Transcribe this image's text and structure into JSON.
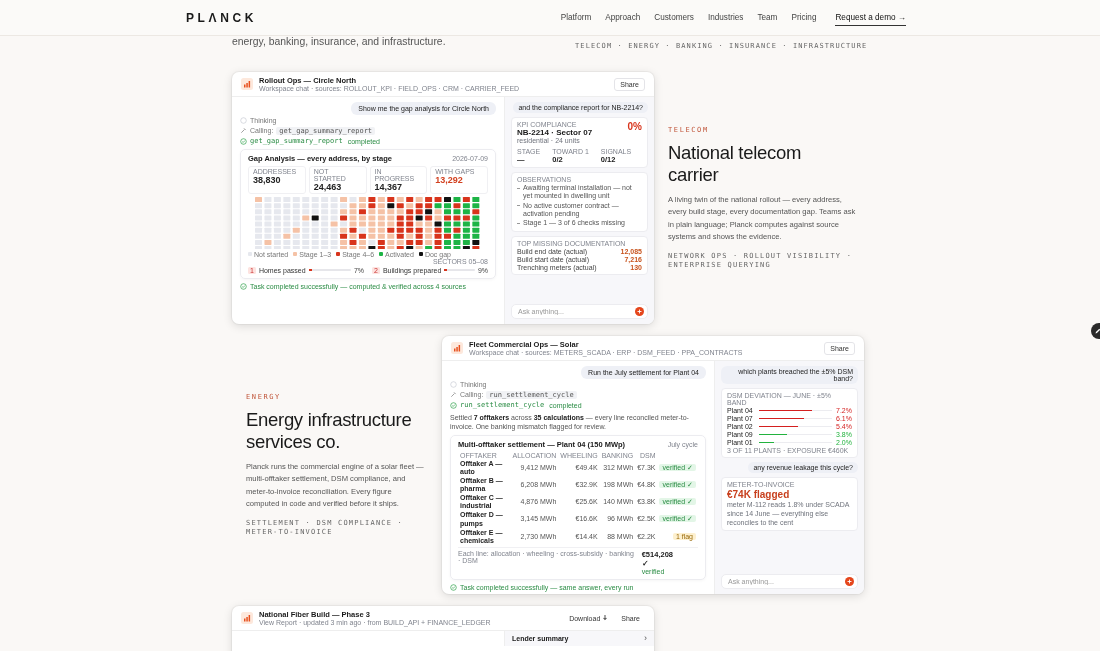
{
  "header": {
    "logo": "PLΛNCK",
    "nav": [
      {
        "label": "Platform"
      },
      {
        "label": "Approach"
      },
      {
        "label": "Customers"
      },
      {
        "label": "Industries"
      },
      {
        "label": "Team"
      },
      {
        "label": "Pricing"
      }
    ],
    "cta": {
      "label": "Request a demo",
      "arrow": "→"
    }
  },
  "intro": {
    "text": "energy, banking, insurance, and infrastructure.",
    "tags": "TELECOM · ENERGY · BANKING · INSURANCE · INFRASTRUCTURE"
  },
  "telecom": {
    "eyebrow": "TELECOM",
    "title": "National telecom carrier",
    "body": "A living twin of the national rollout — every address, every build stage, every documentation gap. Teams ask in plain language; Planck computes against source systems and shows the evidence.",
    "tags": "NETWORK OPS · ROLLOUT VISIBILITY · ENTERPRISE QUERYING",
    "card": {
      "title": "Rollout Ops — Circle North",
      "subtitle": "Workspace chat · sources: ROLLOUT_KPI · FIELD_OPS · CRM · CARRIER_FEED",
      "share": "Share",
      "prompt": "Show me the gap analysis for Circle North",
      "thinking": "Thinking",
      "calling_label": "Calling:",
      "tool": "get_gap_summary_report",
      "result_tool": "get_gap_summary_report",
      "completed": "completed",
      "panel": {
        "title": "Gap Analysis — every address, by stage",
        "date": "2026-07-09",
        "stats": [
          {
            "label": "ADDRESSES",
            "value": "38,830",
            "kind": "normal"
          },
          {
            "label": "NOT STARTED",
            "value": "24,463",
            "kind": "normal"
          },
          {
            "label": "IN PROGRESS",
            "value": "14,367",
            "kind": "normal"
          },
          {
            "label": "WITH GAPS",
            "value": "13,292",
            "kind": "alert"
          }
        ],
        "legend": [
          {
            "label": "Not started",
            "color": "#e6e8ee"
          },
          {
            "label": "Stage 1–3",
            "color": "#f5c2a6"
          },
          {
            "label": "Stage 4–6",
            "color": "#d8341c"
          },
          {
            "label": "Activated",
            "color": "#1db446"
          },
          {
            "label": "Doc gap",
            "color": "#111111"
          }
        ],
        "sectors": "SECTORS 05–08",
        "progress": [
          {
            "index": "1",
            "label": "Homes passed",
            "level": 0.07,
            "reading": "7%"
          },
          {
            "index": "2",
            "label": "Buildings prepared",
            "level": 0.09,
            "reading": "9%"
          }
        ]
      },
      "done": "Task completed successfully — computed & verified across 4 sources",
      "side": {
        "prompt": "and the compliance report for NB-2214?",
        "kpi_label": "KPI COMPLIANCE",
        "kpi_title": "NB-2214 · Sector 07",
        "kpi_value": "0%",
        "kpi_sub": "residential · 24 units",
        "kpi_stats": [
          {
            "label": "STAGE",
            "value": "—"
          },
          {
            "label": "TOWARD 1",
            "value": "0/2"
          },
          {
            "label": "SIGNALS",
            "value": "0/12"
          }
        ],
        "obs_label": "OBSERVATIONS",
        "observations": [
          "Awaiting terminal installation — not yet mounted in dwelling unit",
          "No active customer contract — activation pending",
          "Stage 1 — 3 of 6 checks missing"
        ],
        "docs_label": "TOP MISSING DOCUMENTATION",
        "docs": [
          {
            "label": "Build end date (actual)",
            "value": "12,085"
          },
          {
            "label": "Build start date (actual)",
            "value": "7,216"
          },
          {
            "label": "Trenching meters (actual)",
            "value": "130"
          }
        ],
        "placeholder": "Ask anything..."
      }
    }
  },
  "energy": {
    "eyebrow": "ENERGY",
    "title": "Energy infrastructure services co.",
    "body": "Planck runs the commercial engine of a solar fleet — multi-offtaker settlement, DSM compliance, and meter-to-invoice reconciliation. Every figure computed in code and verified before it ships.",
    "tags": "SETTLEMENT · DSM COMPLIANCE · METER-TO-INVOICE",
    "card": {
      "title": "Fleet Commercial Ops — Solar",
      "subtitle": "Workspace chat · sources: METERS_SCADA · ERP · DSM_FEED · PPA_CONTRACTS",
      "share": "Share",
      "prompt": "Run the July settlement for Plant 04",
      "thinking": "Thinking",
      "calling_label": "Calling:",
      "tool": "run_settlement_cycle",
      "result_tool": "run_settlement_cycle",
      "completed": "completed",
      "summary": "Settled **7 offtakers** across **35 calculations** — every line reconciled meter-to-invoice. One banking mismatch flagged for review.",
      "table": {
        "title": "Multi-offtaker settlement — Plant 04 (150 MWp)",
        "cycle": "July cycle",
        "columns": [
          "OFFTAKER",
          "ALLOCATION",
          "WHEELING",
          "BANKING",
          "DSM"
        ],
        "rows": [
          {
            "cells": [
              "Offtaker A — auto",
              "9,412 MWh",
              "€49.4K",
              "312 MWh",
              "€7.3K"
            ],
            "status": {
              "kind": "verified",
              "label": "verified ✓"
            }
          },
          {
            "cells": [
              "Offtaker B — pharma",
              "6,208 MWh",
              "€32.9K",
              "198 MWh",
              "€4.8K"
            ],
            "status": {
              "kind": "verified",
              "label": "verified ✓"
            }
          },
          {
            "cells": [
              "Offtaker C — industrial",
              "4,876 MWh",
              "€25.6K",
              "140 MWh",
              "€3.8K"
            ],
            "status": {
              "kind": "verified",
              "label": "verified ✓"
            }
          },
          {
            "cells": [
              "Offtaker D — pumps",
              "3,145 MWh",
              "€16.6K",
              "96 MWh",
              "€2.5K"
            ],
            "status": {
              "kind": "verified",
              "label": "verified ✓"
            }
          },
          {
            "cells": [
              "Offtaker E — chemicals",
              "2,730 MWh",
              "€14.4K",
              "88 MWh",
              "€2.2K"
            ],
            "status": {
              "kind": "flag",
              "label": "1 flag"
            }
          }
        ],
        "footnote": "Each line: allocation · wheeling · cross-subsidy · banking · DSM",
        "total": "€514,208 ✓",
        "total_note": "verified"
      },
      "done": "Task completed successfully — same answer, every run",
      "side": {
        "prompt": "which plants breached the ±5% DSM band?",
        "dsm_label": "DSM DEVIATION — JUNE · ±5% BAND",
        "plants": [
          {
            "name": "Plant 04",
            "level": 0.72,
            "reading": "7.2%",
            "color": "#d41f1f"
          },
          {
            "name": "Plant 07",
            "level": 0.61,
            "reading": "6.1%",
            "color": "#d41f1f"
          },
          {
            "name": "Plant 02",
            "level": 0.54,
            "reading": "5.4%",
            "color": "#d41f1f"
          },
          {
            "name": "Plant 09",
            "level": 0.38,
            "reading": "3.8%",
            "color": "#22b23e"
          },
          {
            "name": "Plant 01",
            "level": 0.2,
            "reading": "2.0%",
            "color": "#22b23e"
          }
        ],
        "dsm_note": "3 OF 11 PLANTS · EXPOSURE €460K",
        "prompt2": "any revenue leakage this cycle?",
        "m2i_label": "METER-TO-INVOICE",
        "m2i_value": "€74K flagged",
        "m2i_note": "meter M-112 reads 1.8% under SCADA since 14 June — everything else reconciles to the cent",
        "placeholder": "Ask anything..."
      }
    }
  },
  "fiber_card": {
    "title": "National Fiber Build — Phase 3",
    "subtitle": "View Report · updated 3 min ago · from BUILD_API + FINANCE_LEDGER",
    "download": "Download",
    "share": "Share",
    "panel_title": "Lender summary",
    "chevron": "›"
  }
}
